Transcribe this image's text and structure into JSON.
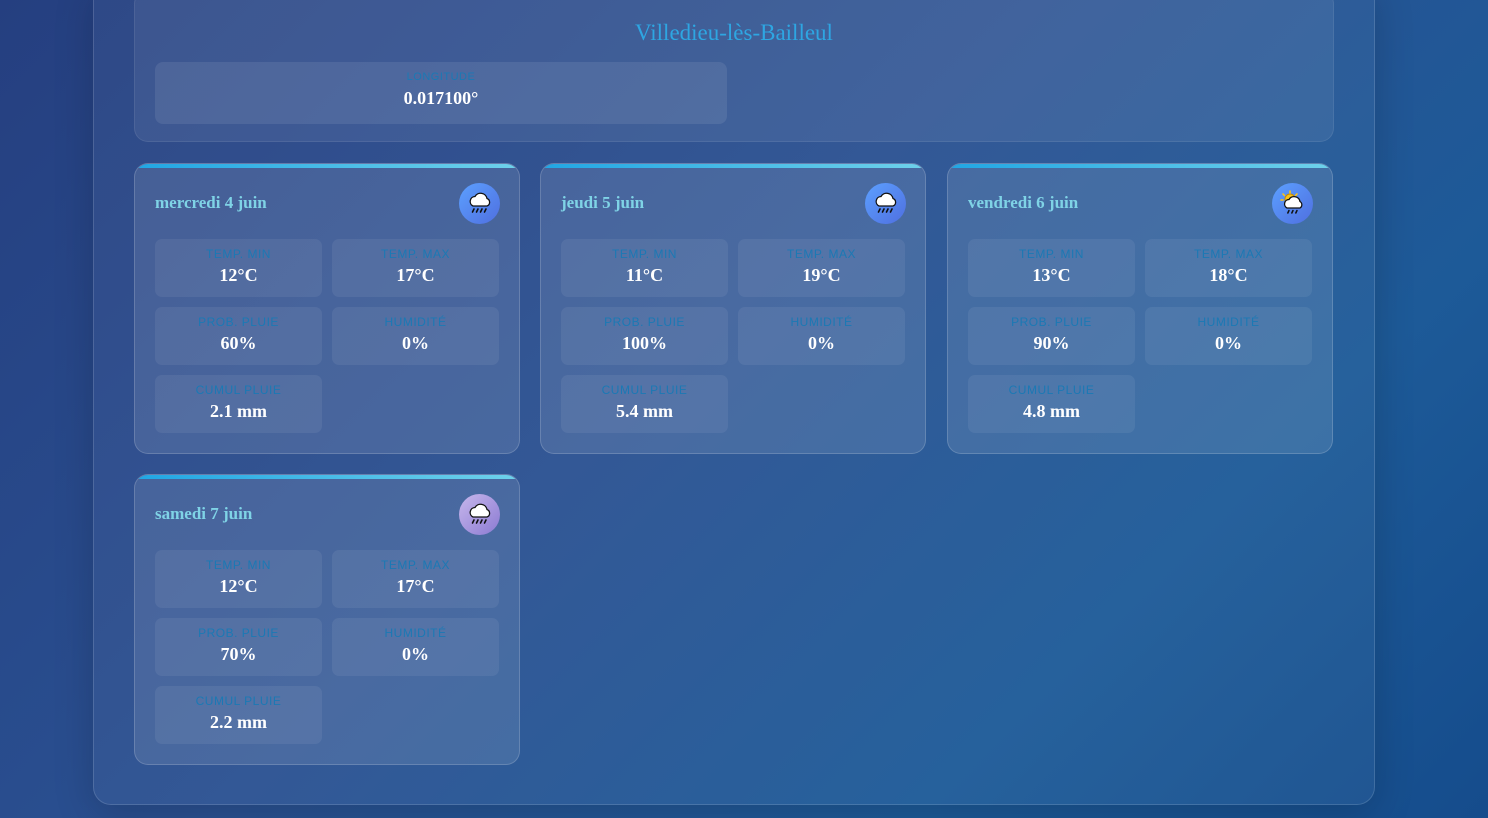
{
  "location": {
    "title": "Villedieu-lès-Bailleul",
    "coord_label": "LONGITUDE",
    "coord_value": "0.017100°"
  },
  "labels": {
    "temp_min": "TEMP. MIN",
    "temp_max": "TEMP. MAX",
    "prob_pluie": "PROB. PLUIE",
    "humidite": "HUMIDITÉ",
    "cumul_pluie": "CUMUL PLUIE"
  },
  "days": [
    {
      "title": "mercredi 4 juin",
      "icon": "rain-cloud-icon",
      "temp_min": "12°C",
      "temp_max": "17°C",
      "prob_pluie": "60%",
      "humidite": "0%",
      "cumul_pluie": "2.1 mm"
    },
    {
      "title": "jeudi 5 juin",
      "icon": "rain-cloud-icon",
      "temp_min": "11°C",
      "temp_max": "19°C",
      "prob_pluie": "100%",
      "humidite": "0%",
      "cumul_pluie": "5.4 mm"
    },
    {
      "title": "vendredi 6 juin",
      "icon": "sun-rain-cloud-icon",
      "temp_min": "13°C",
      "temp_max": "18°C",
      "prob_pluie": "90%",
      "humidite": "0%",
      "cumul_pluie": "4.8 mm"
    },
    {
      "title": "samedi 7 juin",
      "icon": "rain-cloud-icon",
      "temp_min": "12°C",
      "temp_max": "17°C",
      "prob_pluie": "70%",
      "humidite": "0%",
      "cumul_pluie": "2.2 mm"
    }
  ],
  "colors": {
    "accent": "#2ea6e2",
    "day_title": "#7fd3e6",
    "stat_label": "#1b79b4",
    "icon_blue": "#5a8ff5",
    "icon_purple": "#a898de"
  }
}
